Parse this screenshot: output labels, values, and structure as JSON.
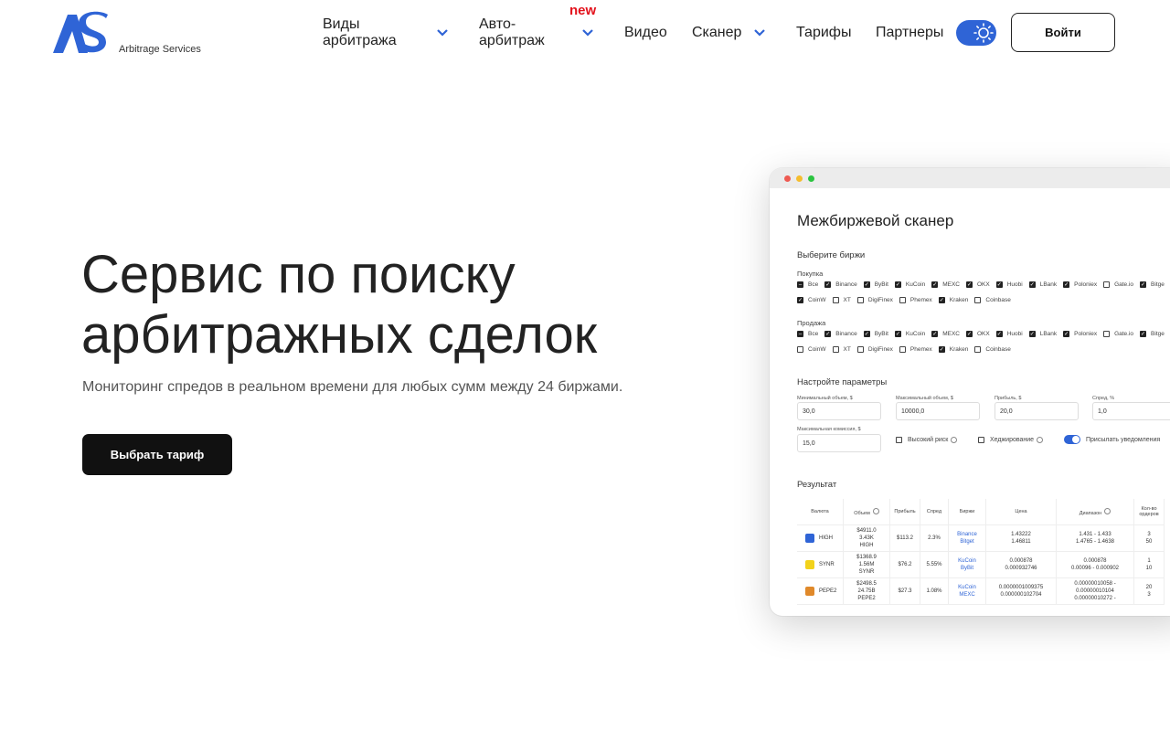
{
  "header": {
    "logo_text": "Arbitrage Services",
    "nav": [
      {
        "label": "Виды арбитража"
      },
      {
        "label": "Авто-арбитраж"
      },
      {
        "label": "Видео"
      },
      {
        "label": "Сканер"
      },
      {
        "label": "Тарифы"
      },
      {
        "label": "Партнеры"
      }
    ],
    "new_badge": "new",
    "login_label": "Войти",
    "accent_color": "#2f64d6"
  },
  "hero": {
    "title_line1": "Сервис по поиску",
    "title_line2": "арбитражных сделок",
    "subtitle": "Мониторинг спредов в реальном времени для любых сумм между 24 биржами.",
    "cta_label": "Выбрать тариф"
  },
  "mock": {
    "title": "Межбиржевой сканер",
    "exchanges_heading": "Выберите биржи",
    "buy_label": "Покупка",
    "sell_label": "Продажа",
    "buy_row1": [
      {
        "name": "Все",
        "checked": "partial"
      },
      {
        "name": "Binance",
        "checked": true
      },
      {
        "name": "ByBit",
        "checked": true
      },
      {
        "name": "KuCoin",
        "checked": true
      },
      {
        "name": "MEXC",
        "checked": true
      },
      {
        "name": "OKX",
        "checked": true
      },
      {
        "name": "Huobi",
        "checked": true
      },
      {
        "name": "LBank",
        "checked": true
      },
      {
        "name": "Poloniex",
        "checked": true
      },
      {
        "name": "Gate.io",
        "checked": false
      },
      {
        "name": "Bitge",
        "checked": true
      }
    ],
    "buy_row2": [
      {
        "name": "CoinW",
        "checked": true
      },
      {
        "name": "XT",
        "checked": false
      },
      {
        "name": "DigiFinex",
        "checked": false
      },
      {
        "name": "Phemex",
        "checked": false
      },
      {
        "name": "Kraken",
        "checked": true
      },
      {
        "name": "Coinbase",
        "checked": false
      }
    ],
    "sell_row1": [
      {
        "name": "Все",
        "checked": "partial"
      },
      {
        "name": "Binance",
        "checked": true
      },
      {
        "name": "ByBit",
        "checked": true
      },
      {
        "name": "KuCoin",
        "checked": true
      },
      {
        "name": "MEXC",
        "checked": true
      },
      {
        "name": "OKX",
        "checked": true
      },
      {
        "name": "Huobi",
        "checked": true
      },
      {
        "name": "LBank",
        "checked": true
      },
      {
        "name": "Poloniex",
        "checked": true
      },
      {
        "name": "Gate.io",
        "checked": false
      },
      {
        "name": "Bitge",
        "checked": true
      }
    ],
    "sell_row2": [
      {
        "name": "CoinW",
        "checked": false
      },
      {
        "name": "XT",
        "checked": false
      },
      {
        "name": "DigiFinex",
        "checked": false
      },
      {
        "name": "Phemex",
        "checked": false
      },
      {
        "name": "Kraken",
        "checked": true
      },
      {
        "name": "Coinbase",
        "checked": false
      }
    ],
    "params_heading": "Настройте параметры",
    "fields": {
      "min_volume_label": "Минимальный объем, $",
      "min_volume": "30,0",
      "max_volume_label": "Максимальный объем, $",
      "max_volume": "10000,0",
      "profit_label": "Прибыль, $",
      "profit": "20,0",
      "spread_label": "Спред, %",
      "spread": "1,0",
      "max_fee_label": "Максимальная комиссия, $",
      "max_fee": "15,0"
    },
    "options": {
      "high_risk": "Высокий риск",
      "hedging": "Хеджирование",
      "notifications": "Присылать уведомления"
    },
    "result_heading": "Результат",
    "table": {
      "headers": [
        "Валюта",
        "Объем",
        "Прибыль",
        "Спред",
        "Биржи",
        "Цена",
        "Диапазон",
        "Кол-во ордеров"
      ],
      "rows": [
        {
          "coin": "HIGH",
          "icon_color": "#2f64d6",
          "volume": "$4911.0\n3.43K\nHIGH",
          "profit": "$113.2",
          "spread": "2.3%",
          "exchanges": "Binance\nBitget",
          "price": "1.43222\n1.46811",
          "range": "1.431 - 1.433\n1.4765 - 1.4638",
          "orders": "3\n50"
        },
        {
          "coin": "SYNR",
          "icon_color": "#f2d21b",
          "volume": "$1368.9\n1.56M\nSYNR",
          "profit": "$76.2",
          "spread": "5.55%",
          "exchanges": "KuCoin\nByBit",
          "price": "0.000878\n0.000932746",
          "range": "0.000878\n0.00096 - 0.000902",
          "orders": "1\n10"
        },
        {
          "coin": "PEPE2",
          "icon_color": "#e0892a",
          "volume": "$2498.5\n24.75B\nPEPE2",
          "profit": "$27.3",
          "spread": "1.08%",
          "exchanges": "KuCoin\nMEXC",
          "price": "0.0000001009375\n0.000000102704",
          "range": "0.00000010058 -\n0.00000010104\n0.00000010272 -",
          "orders": "20\n3"
        }
      ]
    }
  }
}
